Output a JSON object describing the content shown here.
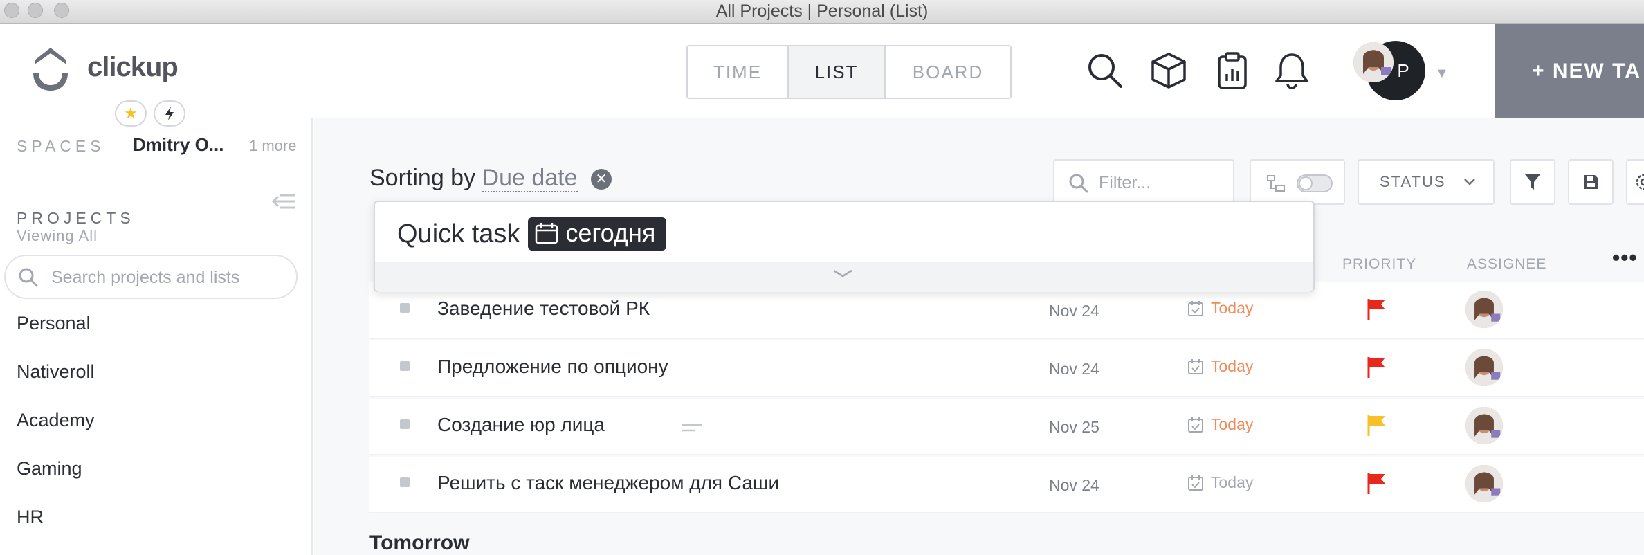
{
  "window": {
    "title": "All Projects | Personal (List)"
  },
  "header": {
    "logo_text": "clickup",
    "views": [
      "TIME",
      "LIST",
      "BOARD"
    ],
    "active_view": "LIST",
    "avatar_initial": "P",
    "new_task_label": "+ NEW TA",
    "icons": [
      "search-icon",
      "box-icon",
      "clipboard-icon",
      "bell-icon",
      "chevron-down-icon"
    ]
  },
  "sidebar": {
    "spaces_label": "SPACES",
    "space_name": "Dmitry O...",
    "more_label": "1 more",
    "projects_label": "PROJECTS",
    "projects_sub": "Viewing All",
    "search_placeholder": "Search projects and lists",
    "projects": [
      "Personal",
      "Nativeroll",
      "Academy",
      "Gaming",
      "HR"
    ]
  },
  "toolbar": {
    "sorting_prefix": "Sorting by",
    "sorting_field": "Due date",
    "filter_placeholder": "Filter...",
    "status_label": "STATUS"
  },
  "quick_task": {
    "text": "Quick task",
    "chip": "сегодня"
  },
  "columns": {
    "priority": "PRIORITY",
    "assignee": "ASSIGNEE"
  },
  "tasks": [
    {
      "name": "Заведение тестовой РК",
      "date": "Nov 24",
      "due": "Today",
      "priority_color": "#e8271d",
      "has_description": false
    },
    {
      "name": "Предложение по опциону",
      "date": "Nov 24",
      "due": "Today",
      "priority_color": "#e8271d",
      "has_description": false
    },
    {
      "name": "Создание юр лица",
      "date": "Nov 25",
      "due": "Today",
      "priority_color": "#f6c026",
      "has_description": true
    },
    {
      "name": "Решить с таск менеджером для Саши",
      "date": "Nov 24",
      "due": "Today",
      "priority_color": "#e8271d",
      "has_description": false
    }
  ],
  "next_group": "Tomorrow",
  "colors": {
    "due_today": "#f08b5a",
    "due_muted": "#a3a7b0",
    "new_task_bg": "#7b7f8b"
  }
}
